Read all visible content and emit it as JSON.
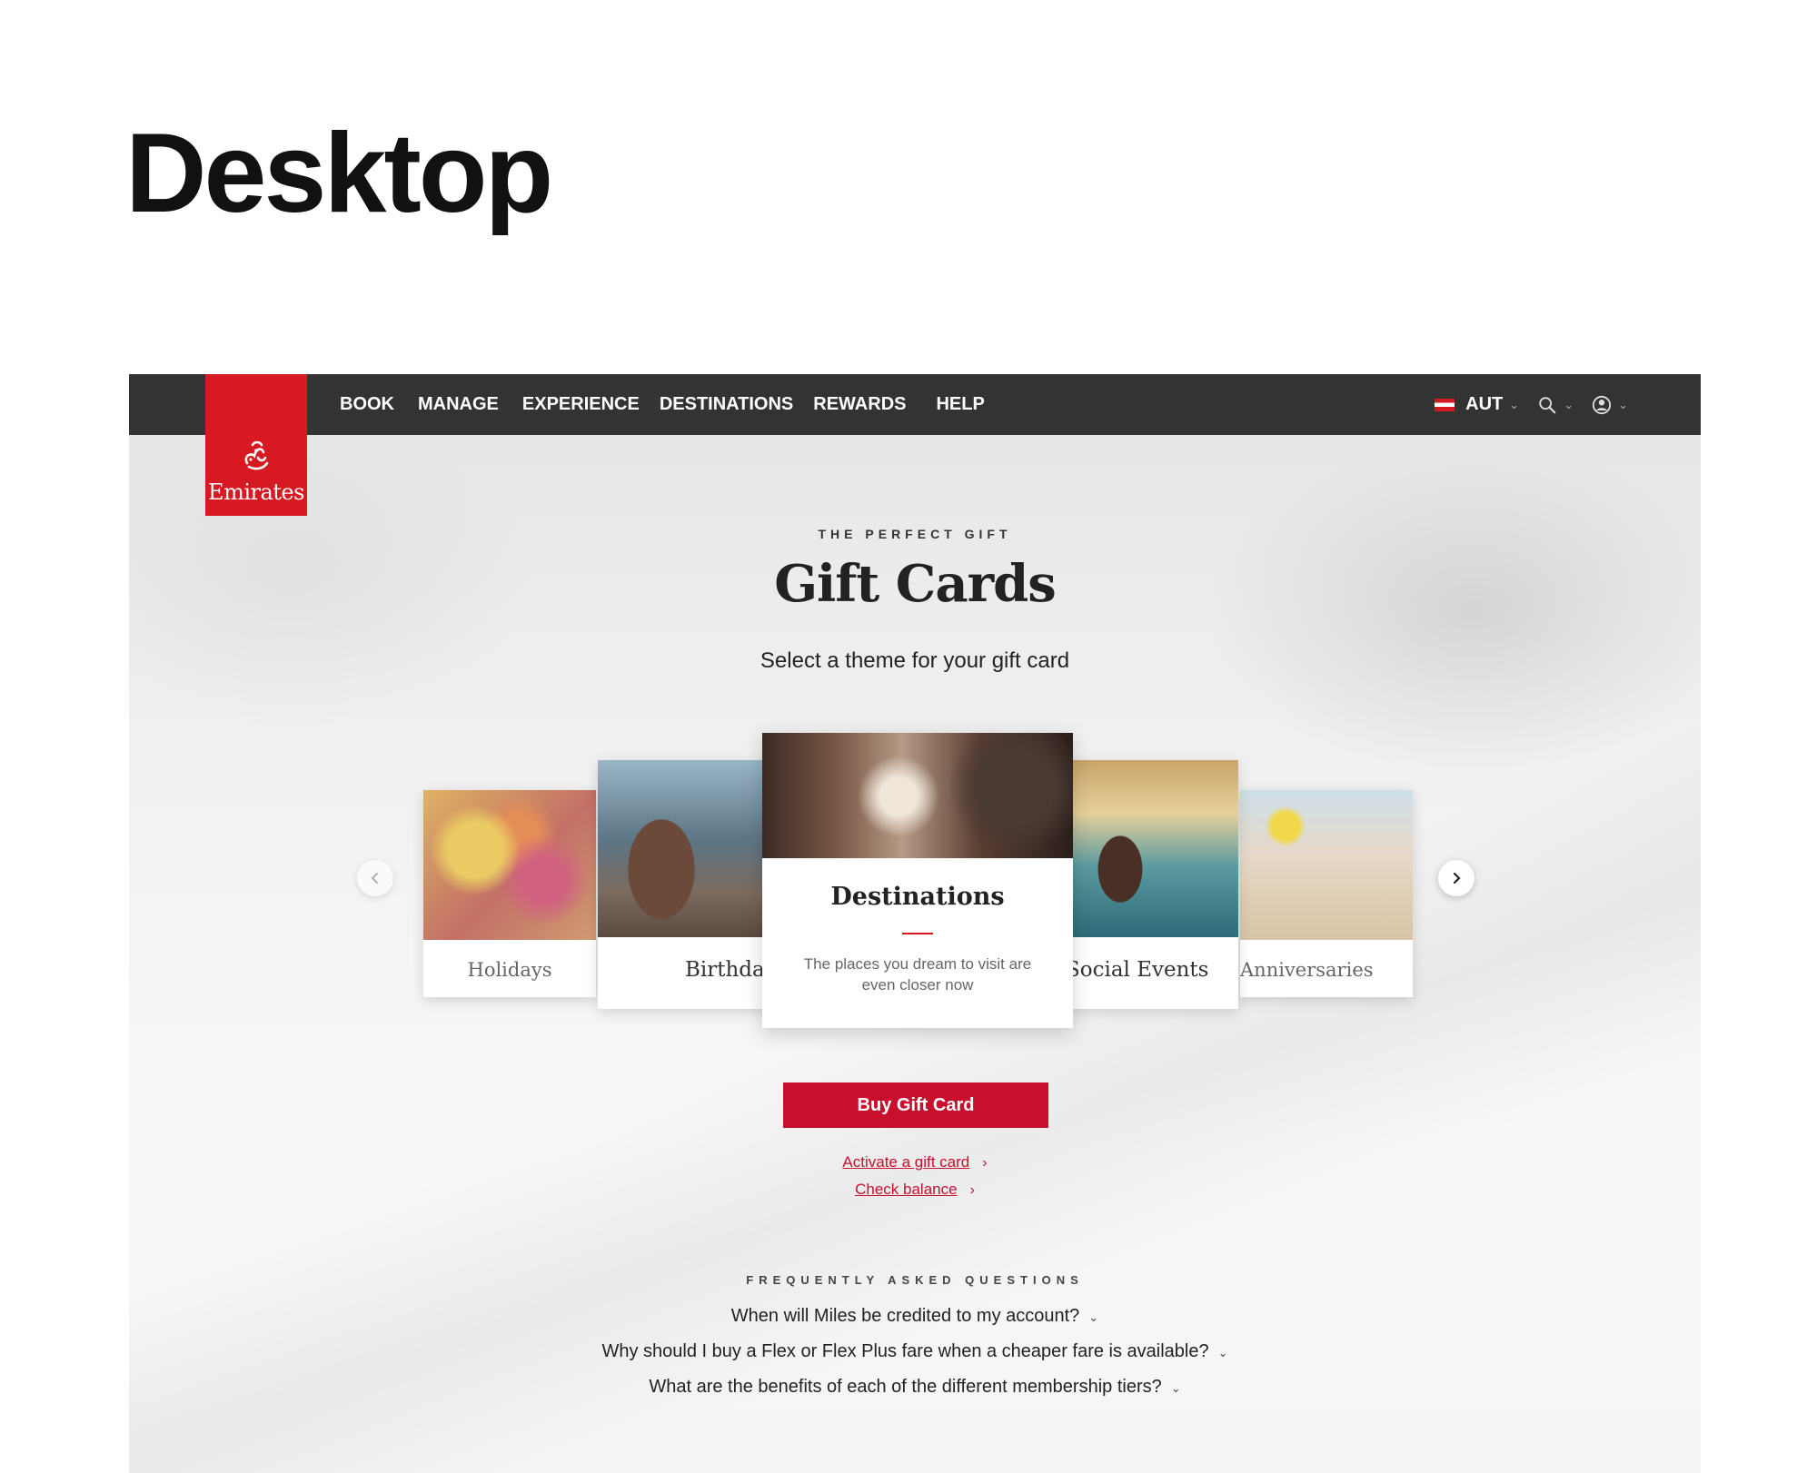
{
  "page_heading": "Desktop",
  "nav": {
    "logo_text": "Emirates",
    "items": [
      "BOOK",
      "MANAGE",
      "EXPERIENCE",
      "DESTINATIONS",
      "REWARDS",
      "HELP"
    ],
    "country": "AUT"
  },
  "hero": {
    "eyebrow": "THE PERFECT GIFT",
    "title": "Gift Cards",
    "subtitle": "Select a theme for your gift card"
  },
  "carousel": {
    "cards": [
      {
        "label": "Holidays"
      },
      {
        "label": "Birthdays"
      },
      {
        "label": "Destinations",
        "description": "The places you dream to visit are even closer now"
      },
      {
        "label": "Social Events"
      },
      {
        "label": "Anniversaries"
      }
    ]
  },
  "actions": {
    "buy_label": "Buy Gift Card",
    "activate_label": "Activate a gift card",
    "balance_label": "Check balance"
  },
  "faq": {
    "eyebrow": "FREQUENTLY ASKED QUESTIONS",
    "questions": [
      "When will Miles be credited to my account?",
      "Why should I buy a Flex or Flex Plus fare when a cheaper fare is available?",
      "What are the benefits of each of the different membership tiers?"
    ]
  },
  "colors": {
    "brand_red": "#d71921",
    "button_red": "#c8102e",
    "nav_bg": "#333333"
  }
}
